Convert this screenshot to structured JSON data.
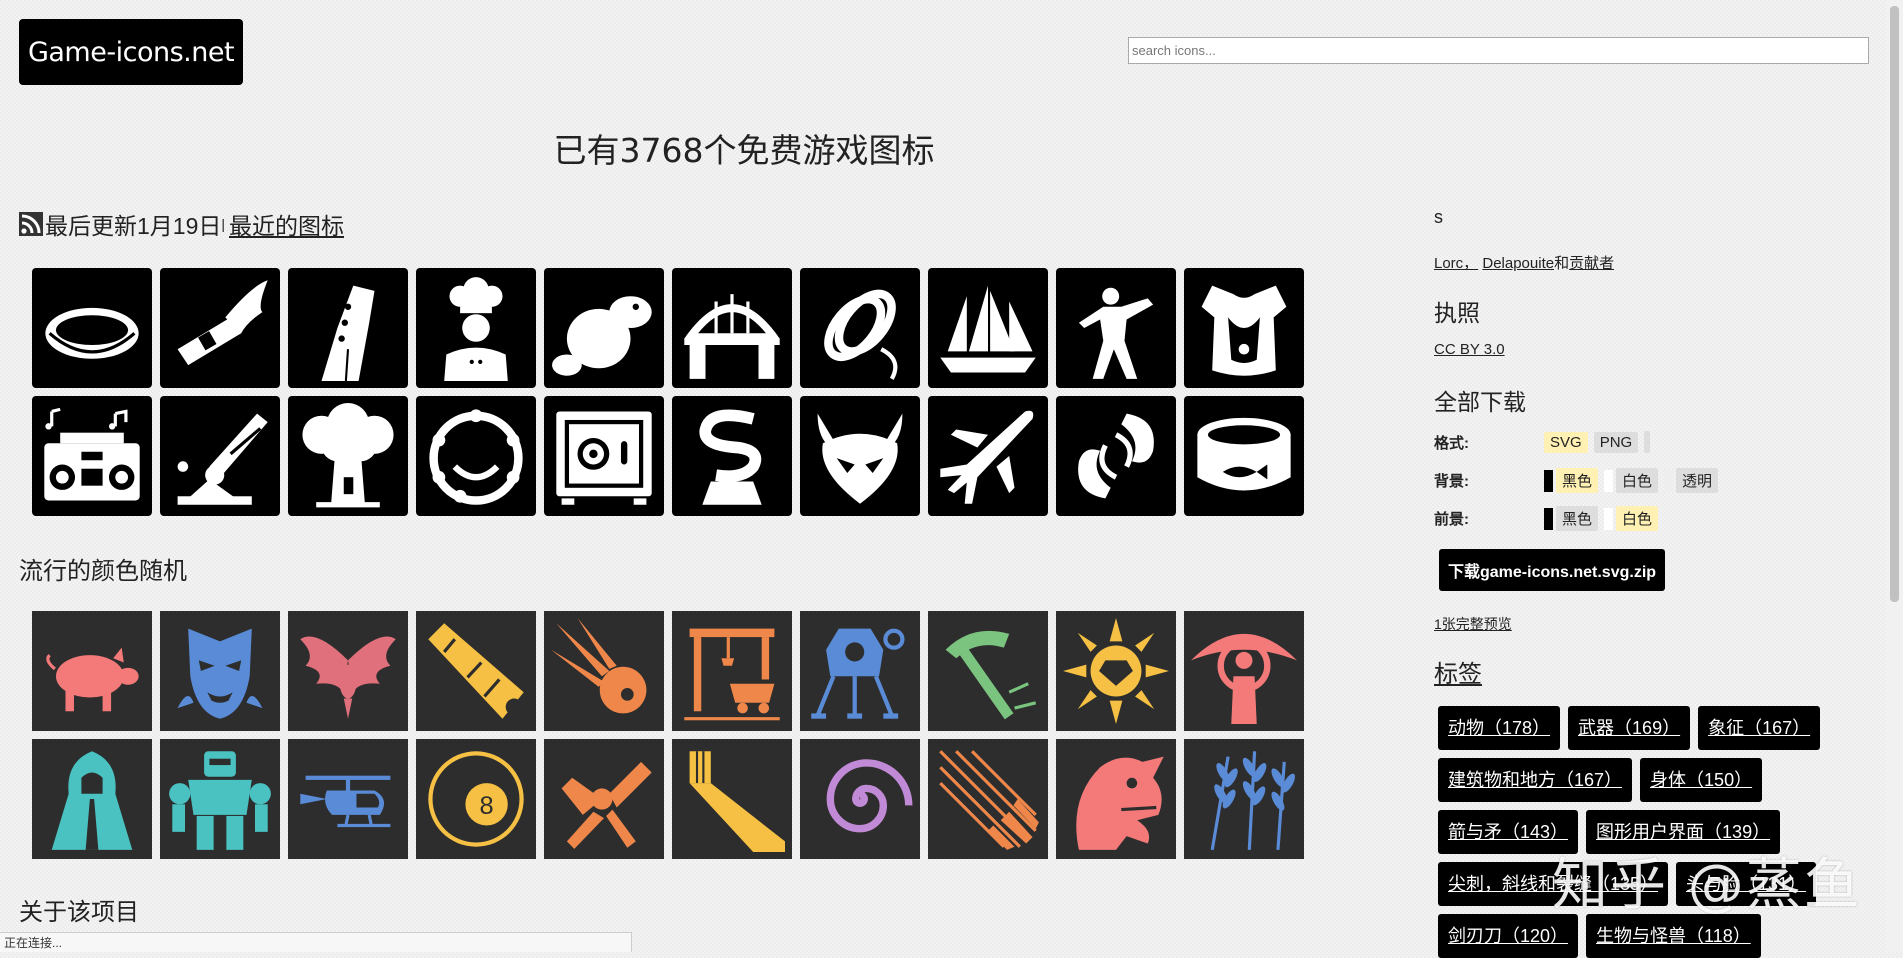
{
  "site": {
    "logo_text": "Game-icons.net"
  },
  "search": {
    "placeholder": "search icons..."
  },
  "headline": "已有3768个免费游戏图标",
  "updated": {
    "text": "最后更新1月19日",
    "separator": "|",
    "recent_link": "最近的图标"
  },
  "recent_icons": [
    {
      "icon": "clam-icon"
    },
    {
      "icon": "winged-arm-icon"
    },
    {
      "icon": "guitar-head-icon"
    },
    {
      "icon": "cook-icon"
    },
    {
      "icon": "beaver-icon"
    },
    {
      "icon": "bridge-icon"
    },
    {
      "icon": "rope-coil-icon"
    },
    {
      "icon": "sailing-ship-icon"
    },
    {
      "icon": "boxer-icon"
    },
    {
      "icon": "cuirass-icon"
    },
    {
      "icon": "boombox-icon"
    },
    {
      "icon": "siege-cannon-icon"
    },
    {
      "icon": "tree-house-icon"
    },
    {
      "icon": "tambourine-icon"
    },
    {
      "icon": "safe-icon"
    },
    {
      "icon": "serpent-pedestal-icon"
    },
    {
      "icon": "horned-mask-icon"
    },
    {
      "icon": "airplane-icon"
    },
    {
      "icon": "koi-fish-icon"
    },
    {
      "icon": "canned-fish-icon"
    }
  ],
  "popular": {
    "title": "流行的颜色随机",
    "icons": [
      {
        "icon": "pig-icon",
        "color": "#f47a7a"
      },
      {
        "icon": "vampire-icon",
        "color": "#5a8bd6"
      },
      {
        "icon": "phoenix-icon",
        "color": "#e0707b"
      },
      {
        "icon": "spyglass-icon",
        "color": "#f5c043"
      },
      {
        "icon": "comet-icon",
        "color": "#f0874a"
      },
      {
        "icon": "mine-cart-icon",
        "color": "#f0874a"
      },
      {
        "icon": "lunar-lander-icon",
        "color": "#5a8bd6"
      },
      {
        "icon": "pickaxe-icon",
        "color": "#7bc47f"
      },
      {
        "icon": "sun-gem-icon",
        "color": "#f5c043"
      },
      {
        "icon": "eye-figure-icon",
        "color": "#f47a7a"
      },
      {
        "icon": "hooded-figure-icon",
        "color": "#4ac2c2"
      },
      {
        "icon": "robot-golem-icon",
        "color": "#4ac2c2"
      },
      {
        "icon": "helicopter-icon",
        "color": "#5a8bd6"
      },
      {
        "icon": "eight-ball-icon",
        "color": "#f5c043"
      },
      {
        "icon": "broken-bone-icon",
        "color": "#f0874a"
      },
      {
        "icon": "window-beam-icon",
        "color": "#f5c043"
      },
      {
        "icon": "spiral-snake-icon",
        "color": "#c18ad6"
      },
      {
        "icon": "arrow-flights-icon",
        "color": "#f0874a"
      },
      {
        "icon": "dragon-head-icon",
        "color": "#f47a7a"
      },
      {
        "icon": "wheat-icon",
        "color": "#5a8bd6"
      }
    ]
  },
  "about": {
    "title": "关于该项目"
  },
  "sidebar": {
    "s_letter": "s",
    "authors": {
      "a1": "Lorc，",
      "a2": "Delapouite",
      "a3": "和",
      "a4": "贡献者"
    },
    "license_title": "执照",
    "license_link": "CC BY 3.0",
    "download_title": "全部下载",
    "format": {
      "label": "格式:",
      "opt1": "SVG",
      "opt2": "PNG"
    },
    "background": {
      "label": "背景:",
      "opt1": "黑色",
      "opt2": "白色",
      "opt3": "透明"
    },
    "foreground": {
      "label": "前景:",
      "opt1": "黑色",
      "opt2": "白色"
    },
    "download_button": "下载game-icons.net.svg.zip",
    "preview_link": "1张完整预览",
    "tags_title": "标签",
    "tags": [
      "动物（178）",
      "武器（169）",
      "象征（167）",
      "建筑物和地方（167）",
      "身体（150）",
      "箭与矛（143）",
      "图形用户界面（139）",
      "尖刺，斜线和裂缝（135）",
      "头与脸（131）",
      "剑刃刀（120）",
      "生物与怪兽（118）"
    ]
  },
  "status_bar": "正在连接...",
  "watermark": "知乎 @蒸鱼"
}
